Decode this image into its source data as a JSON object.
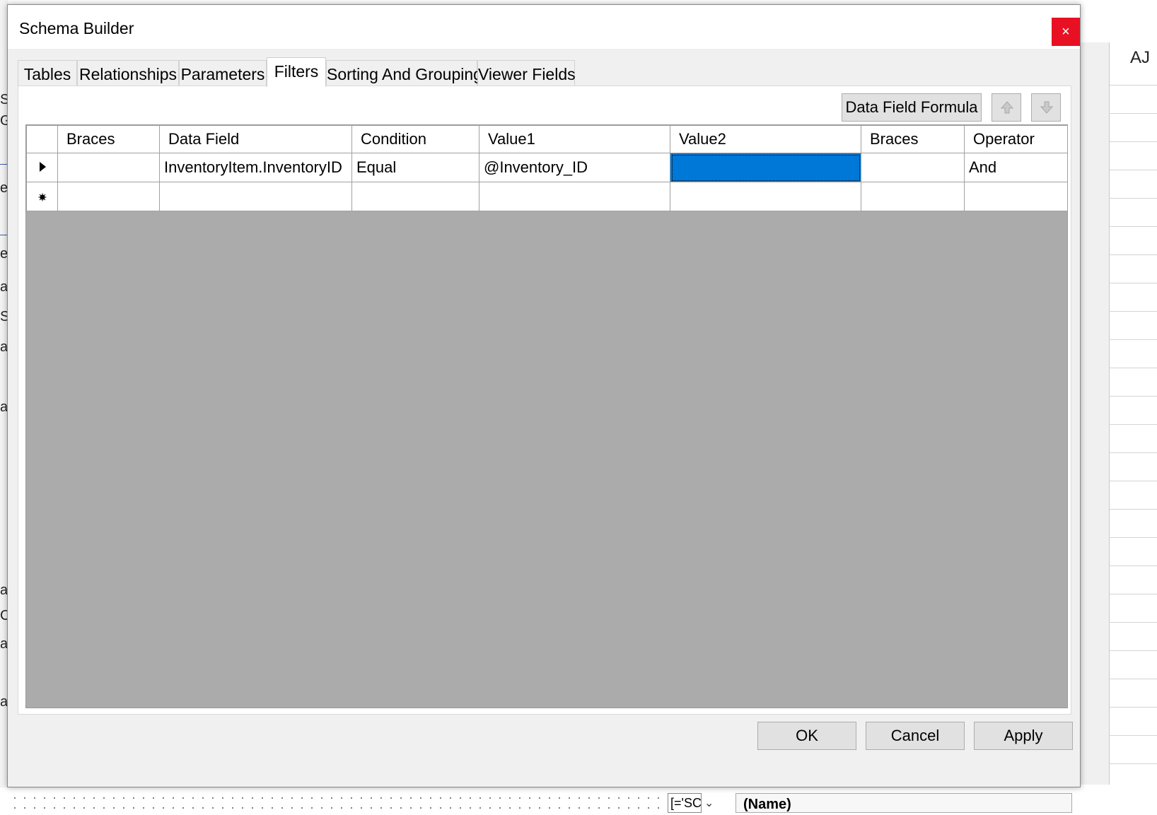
{
  "background": {
    "left_fragments": [
      "Sy",
      "G",
      "e",
      "e",
      "a",
      "Si",
      "a",
      "a",
      "a",
      "C",
      "a",
      "a"
    ],
    "right_column_label": "AJ",
    "combo_value": "[='SC",
    "property_name": "(Name)"
  },
  "dialog": {
    "title": "Schema Builder",
    "close_label": "×",
    "tabs": [
      {
        "label": "Tables",
        "active": false
      },
      {
        "label": "Relationships",
        "active": false
      },
      {
        "label": "Parameters",
        "active": false
      },
      {
        "label": "Filters",
        "active": true
      },
      {
        "label": "Sorting And Grouping",
        "active": false
      },
      {
        "label": "Viewer Fields",
        "active": false
      }
    ],
    "toolbar": {
      "formula_label": "Data Field Formula",
      "move_up_icon": "arrow-up-icon",
      "move_down_icon": "arrow-down-icon"
    },
    "grid": {
      "columns": [
        "Braces",
        "Data Field",
        "Condition",
        "Value1",
        "Value2",
        "Braces",
        "Operator"
      ],
      "rows": [
        {
          "indicator": "current-row-arrow",
          "cells": [
            "",
            "InventoryItem.InventoryID",
            "Equal",
            "@Inventory_ID",
            "",
            "",
            "And"
          ],
          "selected_col": 4
        },
        {
          "indicator": "new-row-star",
          "cells": [
            "",
            "",
            "",
            "",
            "",
            "",
            ""
          ]
        }
      ],
      "empty_area_color": "#ababab",
      "selection_color": "#0078d7"
    },
    "footer": {
      "ok_label": "OK",
      "cancel_label": "Cancel",
      "apply_label": "Apply"
    }
  }
}
